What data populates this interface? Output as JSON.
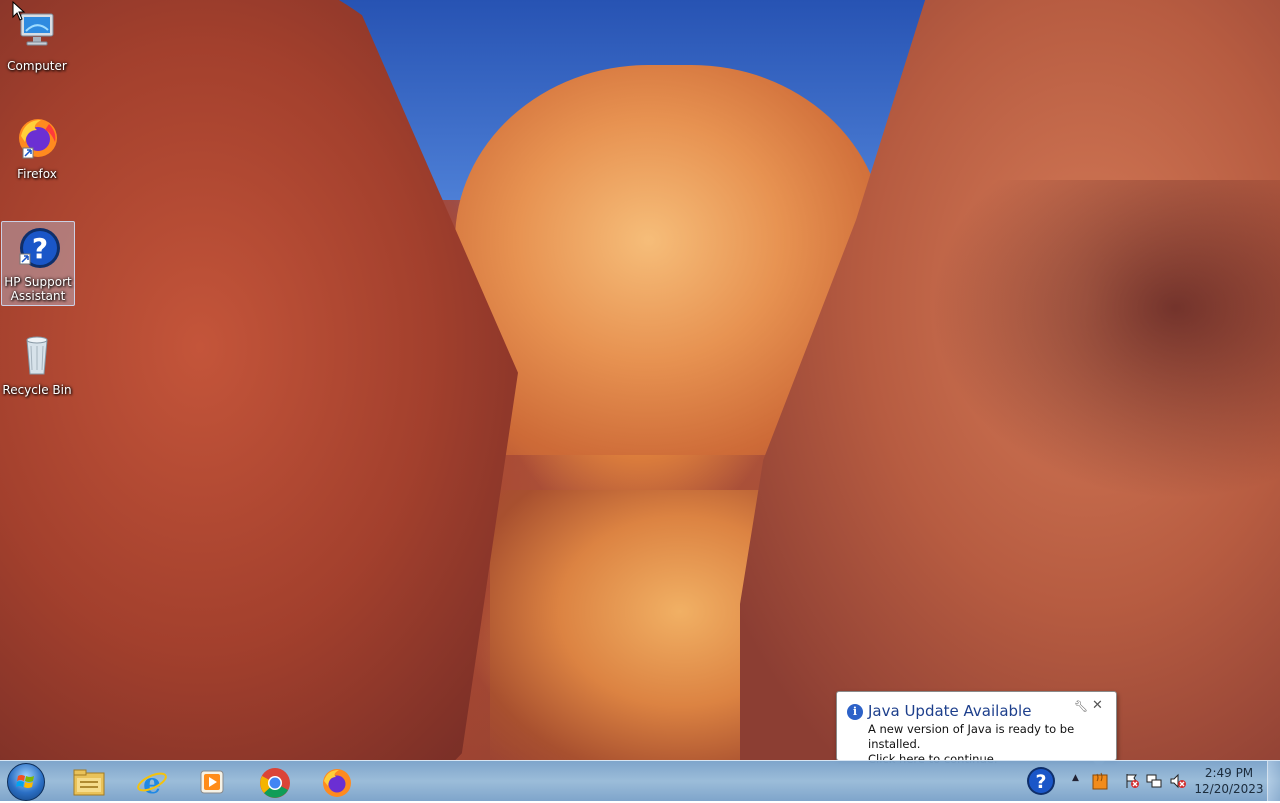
{
  "desktop": {
    "icons": [
      {
        "label": "Computer"
      },
      {
        "label": "Firefox"
      },
      {
        "label": "HP Support Assistant"
      },
      {
        "label": "Recycle Bin"
      }
    ]
  },
  "notification": {
    "title": "Java Update Available",
    "message_line1": "A new version of Java is ready to be installed.",
    "message_line2": "Click here to continue."
  },
  "taskbar": {
    "pinned": [
      "file-explorer-icon",
      "internet-explorer-icon",
      "media-player-icon",
      "chrome-icon",
      "firefox-icon"
    ],
    "clock": {
      "time": "2:49 PM",
      "date": "12/20/2023"
    }
  },
  "colors": {
    "taskbar": "#96b9d7",
    "balloon_title": "#1d3f8c"
  }
}
